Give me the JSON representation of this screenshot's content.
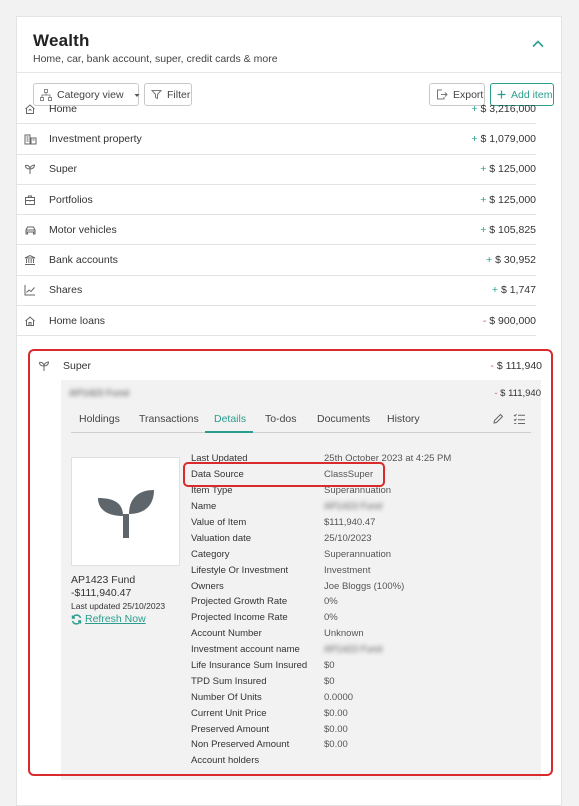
{
  "header": {
    "title": "Wealth",
    "subtitle": "Home, car, bank account, super, credit cards & more"
  },
  "toolbar": {
    "category_view": "Category view",
    "filter": "Filter",
    "export": "Export",
    "add_item": "Add item"
  },
  "rows": [
    {
      "label": "Home",
      "sign": "+",
      "amount": "$ 3,216,000",
      "icon": "house-icon"
    },
    {
      "label": "Investment property",
      "sign": "+",
      "amount": "$ 1,079,000",
      "icon": "buildings-icon"
    },
    {
      "label": "Super",
      "sign": "+",
      "amount": "$ 125,000",
      "icon": "sprout-icon"
    },
    {
      "label": "Portfolios",
      "sign": "+",
      "amount": "$ 125,000",
      "icon": "briefcase-icon"
    },
    {
      "label": "Motor vehicles",
      "sign": "+",
      "amount": "$ 105,825",
      "icon": "car-icon"
    },
    {
      "label": "Bank accounts",
      "sign": "+",
      "amount": "$ 30,952",
      "icon": "bank-icon"
    },
    {
      "label": "Shares",
      "sign": "+",
      "amount": "$ 1,747",
      "icon": "chart-line-icon"
    },
    {
      "label": "Home loans",
      "sign": "-",
      "amount": "$ 900,000",
      "icon": "house-outline-icon"
    }
  ],
  "super_open": {
    "label": "Super",
    "sign": "-",
    "amount": "$ 111,940",
    "sub_item": {
      "name": "AP1423 Fund",
      "sign": "-",
      "amount": "$ 111,940"
    },
    "tabs": [
      "Holdings",
      "Transactions",
      "Details",
      "To-dos",
      "Documents",
      "History"
    ],
    "active_tab": "Details",
    "fund": {
      "name": "AP1423 Fund",
      "value": "-$111,940.47",
      "last_updated": "Last updated 25/10/2023",
      "refresh": "Refresh Now"
    },
    "details": [
      {
        "label": "Last Updated",
        "value": "25th October 2023 at 4:25 PM"
      },
      {
        "label": "Data Source",
        "value": "ClassSuper"
      },
      {
        "label": "Item Type",
        "value": "Superannuation"
      },
      {
        "label": "Name",
        "value": "AP1423 Fund",
        "blurred": true
      },
      {
        "label": "Value of Item",
        "value": "$111,940.47"
      },
      {
        "label": "Valuation date",
        "value": "25/10/2023"
      },
      {
        "label": "Category",
        "value": "Superannuation"
      },
      {
        "label": "Lifestyle Or Investment",
        "value": "Investment"
      },
      {
        "label": "Owners",
        "value": "Joe Bloggs (100%)"
      },
      {
        "label": "Projected Growth Rate",
        "value": "0%"
      },
      {
        "label": "Projected Income Rate",
        "value": "0%"
      },
      {
        "label": "Account Number",
        "value": "Unknown"
      },
      {
        "label": "Investment account name",
        "value": "AP1423 Fund",
        "blurred": true
      },
      {
        "label": "Life Insurance Sum Insured",
        "value": "$0"
      },
      {
        "label": "TPD Sum Insured",
        "value": "$0"
      },
      {
        "label": "Number Of Units",
        "value": "0.0000"
      },
      {
        "label": "Current Unit Price",
        "value": "$0.00"
      },
      {
        "label": "Preserved Amount",
        "value": "$0.00"
      },
      {
        "label": "Non Preserved Amount",
        "value": "$0.00"
      },
      {
        "label": "Account holders",
        "value": ""
      }
    ]
  },
  "colors": {
    "accent": "#2a9d8f",
    "negative": "#d9534f",
    "highlight": "#d92b2b"
  }
}
